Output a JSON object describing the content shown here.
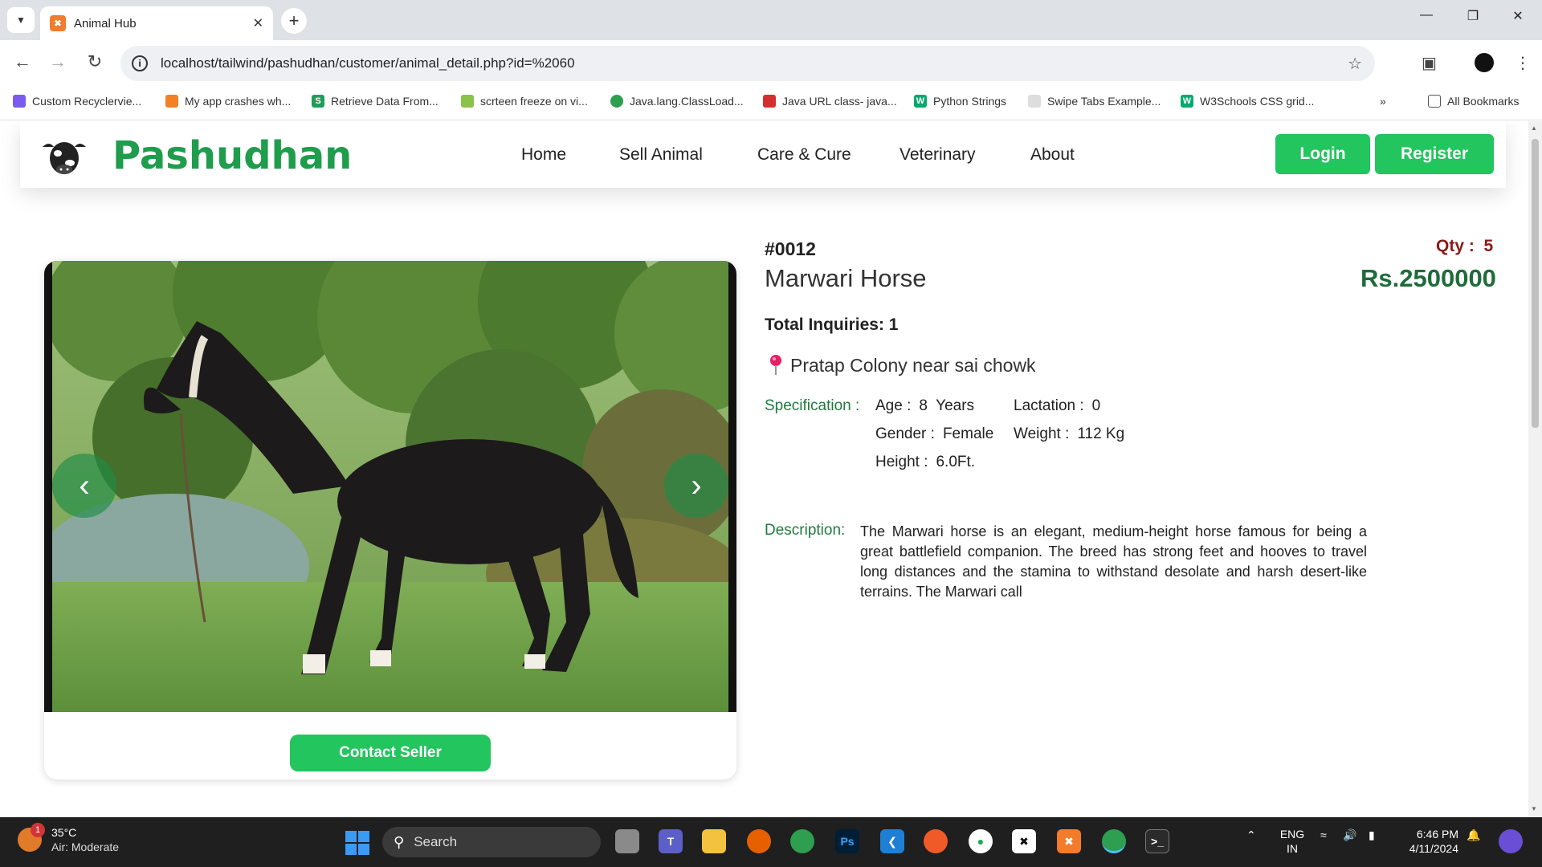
{
  "browser": {
    "tab_title": "Animal Hub",
    "tab_favicon": "xampp-icon",
    "url": "localhost/tailwind/pashudhan/customer/animal_detail.php?id=%2060",
    "bookmarks": [
      {
        "label": "Custom Recyclervie...",
        "color": "#7a5cf0"
      },
      {
        "label": "My app crashes wh...",
        "color": "#f48024"
      },
      {
        "label": "Retrieve Data From...",
        "color": "#1e9e5a"
      },
      {
        "label": "scrteen freeze on vi...",
        "color": "#8bc34a"
      },
      {
        "label": "Java.lang.ClassLoad...",
        "color": "#2e9e4f"
      },
      {
        "label": "Java URL class- java...",
        "color": "#d32f2f"
      },
      {
        "label": "Python Strings",
        "color": "#04aa6d"
      },
      {
        "label": "Swipe Tabs Example...",
        "color": "#dddddd"
      },
      {
        "label": "W3Schools CSS grid...",
        "color": "#04aa6d"
      }
    ],
    "all_bookmarks": "All Bookmarks"
  },
  "site": {
    "brand": "Pashudhan",
    "nav": [
      "Home",
      "Sell Animal",
      "Care & Cure",
      "Veterinary",
      "About"
    ],
    "login": "Login",
    "register": "Register"
  },
  "animal": {
    "id": "#0012",
    "name": "Marwari Horse",
    "qty_label": "Qty :",
    "qty": "5",
    "price": "Rs.2500000",
    "inquiries": "Total Inquiries: 1",
    "location": "Pratap Colony near sai chowk",
    "spec_label": "Specification :",
    "specs": [
      {
        "key": "Age :",
        "value": "8  Years"
      },
      {
        "key": "Lactation :",
        "value": "0"
      },
      {
        "key": "Gender :",
        "value": "Female"
      },
      {
        "key": "Weight :",
        "value": "112 Kg"
      },
      {
        "key": "Height :",
        "value": "6.0Ft."
      }
    ],
    "desc_label": "Description:",
    "description": "The Marwari horse is an elegant, medium-height horse famous for being a great battlefield companion. The breed has strong feet and hooves to travel long distances and the stamina to withstand desolate and harsh desert-like terrains. The Marwari call",
    "contact": "Contact Seller"
  },
  "taskbar": {
    "temp": "35°C",
    "weather": "Air: Moderate",
    "badge": "1",
    "search": "Search",
    "lang1": "ENG",
    "lang2": "IN",
    "time": "6:46 PM",
    "date": "4/11/2024"
  }
}
